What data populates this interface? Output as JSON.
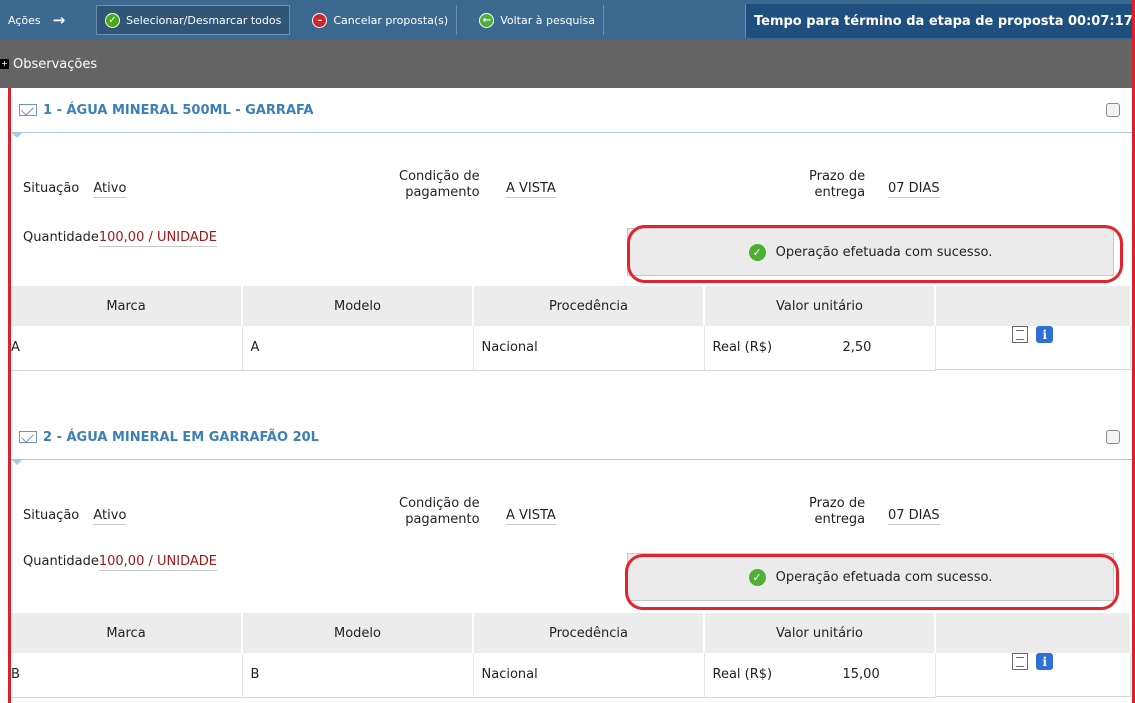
{
  "toolbar": {
    "acoes_label": "Ações",
    "select_all_label": "Selecionar/Desmarcar todos",
    "cancel_label": "Cancelar proposta(s)",
    "back_label": "Voltar à pesquisa",
    "timer_text": "Tempo para término da etapa de proposta 00:07:17"
  },
  "observacoes": {
    "label": "Observações"
  },
  "items": [
    {
      "title": "1 - ÁGUA MINERAL 500ML - GARRAFA",
      "situacao_label": "Situação",
      "situacao_value": "Ativo",
      "condicao_label_1": "Condição de",
      "condicao_label_2": "pagamento",
      "condicao_value": "A VISTA",
      "prazo_label_1": "Prazo de",
      "prazo_label_2": "entrega",
      "prazo_value": "07 DIAS",
      "quantidade_label": "Quantidade",
      "quantidade_value": "100,00 / UNIDADE",
      "success_message": "Operação efetuada com sucesso.",
      "columns": [
        "Marca",
        "Modelo",
        "Procedência",
        "Valor unitário",
        ""
      ],
      "row": {
        "marca": "A",
        "modelo": "A",
        "procedencia": "Nacional",
        "moeda": "Real (R$)",
        "valor": "2,50"
      }
    },
    {
      "title": "2 - ÁGUA MINERAL EM GARRAFÃO 20L",
      "situacao_label": "Situação",
      "situacao_value": "Ativo",
      "condicao_label_1": "Condição de",
      "condicao_label_2": "pagamento",
      "condicao_value": "A VISTA",
      "prazo_label_1": "Prazo de",
      "prazo_label_2": "entrega",
      "prazo_value": "07 DIAS",
      "quantidade_label": "Quantidade",
      "quantidade_value": "100,00 / UNIDADE",
      "success_message": "Operação efetuada com sucesso.",
      "columns": [
        "Marca",
        "Modelo",
        "Procedência",
        "Valor unitário",
        ""
      ],
      "row": {
        "marca": "B",
        "modelo": "B",
        "procedencia": "Nacional",
        "moeda": "Real (R$)",
        "valor": "15,00"
      }
    }
  ],
  "colors": {
    "toolbar": "#3c6990",
    "accent_title": "#3b80b7",
    "highlight_ring": "#e4222b",
    "success": "#4fae34"
  }
}
